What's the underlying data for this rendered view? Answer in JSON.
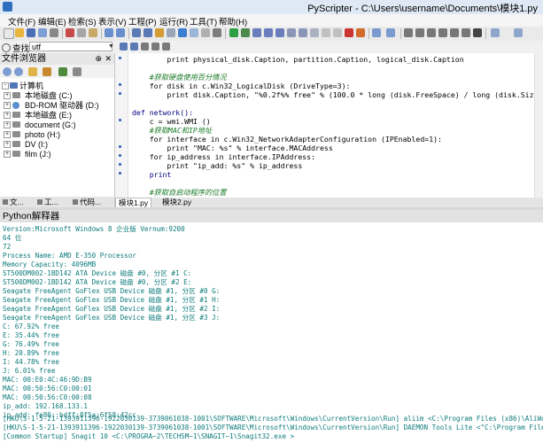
{
  "window": {
    "title": "PyScripter - C:\\Users\\username\\Documents\\模块1.py"
  },
  "menu": [
    "文件(F)",
    "编辑(E)",
    "检索(S)",
    "表示(V)",
    "工程(P)",
    "运行(R)",
    "工具(T)",
    "帮助(H)"
  ],
  "search": {
    "label": "查找:",
    "value": "utf"
  },
  "file_browser": {
    "title": "文件浏览器",
    "tree": [
      "计算机",
      "本地磁盘 (C:)",
      "BD-ROM 驱动器 (D:)",
      "本地磁盘 (E:)",
      "document (G:)",
      "photo (H:)",
      "DV (I:)",
      "film (J:)"
    ],
    "bottom_tabs": [
      "文...",
      "工...",
      "代码..."
    ]
  },
  "editor": {
    "tabs": [
      "模块1.py",
      "模块2.py"
    ],
    "lines": [
      "        print physical_disk.Caption, partition.Caption, logical_disk.Caption",
      "",
      "    #获取硬盘使用百分情况",
      "    for disk in c.Win32_LogicalDisk (DriveType=3):",
      "        print disk.Caption, \"%0.2f%% free\" % (100.0 * long (disk.FreeSpace) / long (disk.Size))",
      "",
      "def network():",
      "    c = wmi.WMI ()",
      "    #获取MAC和IP地址",
      "    for interface in c.Win32_NetworkAdapterConfiguration (IPEnabled=1):",
      "        print \"MAC: %s\" % interface.MACAddress",
      "    for ip_address in interface.IPAddress:",
      "        print \"ip_add: %s\" % ip_address",
      "    print",
      "",
      "    #获取自启动程序的位置"
    ]
  },
  "interpreter": {
    "title": "Python解释器",
    "lines": [
      "Version:Microsoft Windows 8 企业版 Vernum:9200",
      "64 位",
      "72",
      "Process Name: AMD E-350 Processor",
      "Memory Capacity: 4096MB",
      "ST500DM002-1BD142 ATA Device 磁盘 #0, 分区 #1 C:",
      "ST500DM002-1BD142 ATA Device 磁盘 #0, 分区 #2 E:",
      "Seagate FreeAgent GoFlex USB Device 磁盘 #1, 分区 #0 G:",
      "Seagate FreeAgent GoFlex USB Device 磁盘 #1, 分区 #1 H:",
      "Seagate FreeAgent GoFlex USB Device 磁盘 #1, 分区 #2 I:",
      "Seagate FreeAgent GoFlex USB Device 磁盘 #1, 分区 #3 J:",
      "C: 67.92% free",
      "E: 35.44% free",
      "G: 76.49% free",
      "H: 20.89% free",
      "I: 44.78% free",
      "J: 6.01% free",
      "MAC: 00:E0:4C:46:9D:B9",
      "MAC: 00:50:56:C0:00:01",
      "MAC: 00:50:56:C0:00:08",
      "ip_add: 192.168.133.1",
      "ip_add: fe80::bdff:8f5a:6f58:42cc",
      "",
      "[HKU\\S-1-5-21-1393911396-1922030139-3739061038-1001\\SOFTWARE\\Microsoft\\Windows\\CurrentVersion\\Run] aliim <C:\\Program Files (x86)\\AliWangWang\\",
      "[HKU\\S-1-5-21-1393911396-1922030139-3739061038-1001\\SOFTWARE\\Microsoft\\Windows\\CurrentVersion\\Run] DAEMON Tools Lite <\"C:\\Program Files (x86)\\",
      "[Common Startup] Snagit 10 <C:\\PROGRA~2\\TECHSM~1\\SNAGIT~1\\Snagit32.exe >"
    ]
  }
}
